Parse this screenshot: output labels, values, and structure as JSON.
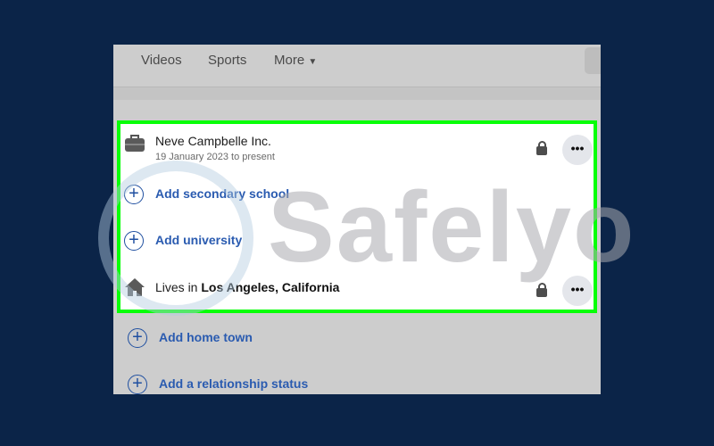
{
  "nav": {
    "items": [
      "Videos",
      "Sports",
      "More"
    ],
    "more_icon": "caret-down-icon"
  },
  "work": {
    "title": "Neve Campbelle Inc.",
    "subtitle": "19 January 2023 to present",
    "icon": "briefcase-icon"
  },
  "links": {
    "secondary_school": "Add secondary school",
    "university": "Add university",
    "home_town": "Add home town",
    "relationship": "Add a relationship status"
  },
  "lives": {
    "prefix": "Lives in ",
    "city": "Los Angeles, California",
    "icon": "home-icon"
  },
  "watermark": "Safelyo",
  "colors": {
    "highlight": "#06ff06",
    "link": "#2a5bb0",
    "background": "#0b2448"
  }
}
